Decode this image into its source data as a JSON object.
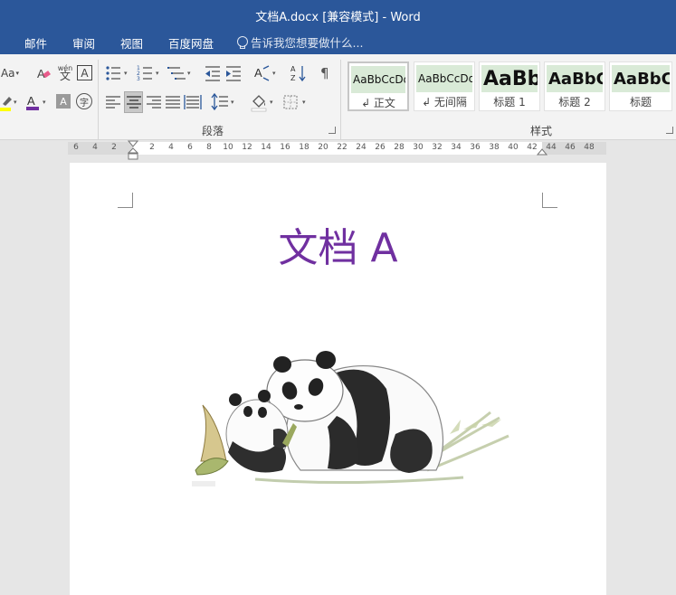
{
  "window": {
    "title": "文档A.docx [兼容模式] - Word"
  },
  "tabs": [
    {
      "label": "邮件"
    },
    {
      "label": "审阅"
    },
    {
      "label": "视图"
    },
    {
      "label": "百度网盘"
    }
  ],
  "tell_me": {
    "placeholder": "告诉我您想要做什么..."
  },
  "ribbon": {
    "font_group": {
      "aa_label": "Aa",
      "wen_label": "wén",
      "wen_char": "文",
      "a_box_label": "A",
      "font_color_label": "A",
      "shading_label": "A",
      "zi_label": "字"
    },
    "paragraph_group": {
      "label": "段落"
    },
    "styles_group": {
      "label": "样式",
      "styles": [
        {
          "sample": "AaBbCcDd",
          "name": "↲ 正文",
          "selected": true
        },
        {
          "sample": "AaBbCcDd",
          "name": "↲ 无间隔",
          "selected": false
        },
        {
          "sample": "AaBb",
          "name": "标题 1",
          "selected": false
        },
        {
          "sample": "AaBbC",
          "name": "标题 2",
          "selected": false
        },
        {
          "sample": "AaBbC",
          "name": "标题",
          "selected": false
        }
      ]
    }
  },
  "ruler": {
    "left_labels": [
      "6",
      "4",
      "2"
    ],
    "right_labels": [
      "2",
      "4",
      "6",
      "8",
      "10",
      "12",
      "14",
      "16",
      "18",
      "20",
      "22",
      "24",
      "26",
      "28",
      "30",
      "32",
      "34",
      "36",
      "38",
      "40",
      "42",
      "44",
      "46",
      "48"
    ]
  },
  "document": {
    "title": "文档 A"
  },
  "colors": {
    "accent": "#2b579a",
    "title_color": "#7030a0",
    "style_highlight": "#d9ead7"
  }
}
